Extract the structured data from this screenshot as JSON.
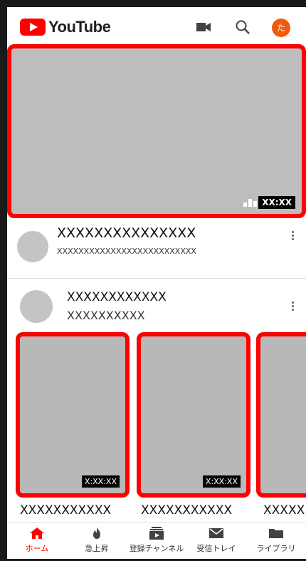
{
  "header": {
    "logo_text": "YouTube",
    "avatar_letter": "た",
    "brand_color": "#ff0000"
  },
  "hero": {
    "duration": "XX:XX"
  },
  "feed": {
    "item1": {
      "title": "XXXXXXXXXXXXXXX",
      "subtitle": "XXXXXXXXXXXXXXXXXXXXXXXXXX"
    },
    "item2": {
      "title": "XXXXXXXXXXXX",
      "subtitle": "XXXXXXXXXX"
    }
  },
  "shelf": {
    "thumbs": [
      {
        "duration": "X:XX:XX",
        "title": "XXXXXXXXXXX"
      },
      {
        "duration": "X:XX:XX",
        "title": "XXXXXXXXXXX"
      },
      {
        "duration": "",
        "title": "XXXXX"
      }
    ]
  },
  "bottom_nav": {
    "items": [
      {
        "label": "ホーム",
        "icon": "home-icon",
        "active": true
      },
      {
        "label": "急上昇",
        "icon": "fire-icon",
        "active": false
      },
      {
        "label": "登録チャンネル",
        "icon": "subscriptions-icon",
        "active": false
      },
      {
        "label": "受信トレイ",
        "icon": "mail-icon",
        "active": false
      },
      {
        "label": "ライブラリ",
        "icon": "folder-icon",
        "active": false
      }
    ]
  }
}
